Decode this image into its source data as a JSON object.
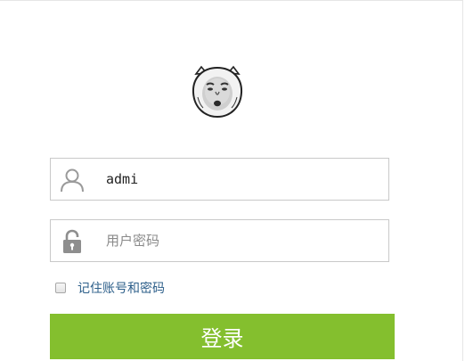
{
  "login": {
    "username_value": "admi",
    "password_placeholder": "用户密码",
    "remember_label": "记住账号和密码",
    "submit_label": "登录"
  },
  "icons": {
    "avatar": "cartoon-face-avatar",
    "username": "user-icon",
    "password": "lock-icon"
  },
  "colors": {
    "submit_button": "#84bf2e",
    "remember_link": "#2d5f8a",
    "field_border": "#c9c9c9"
  }
}
